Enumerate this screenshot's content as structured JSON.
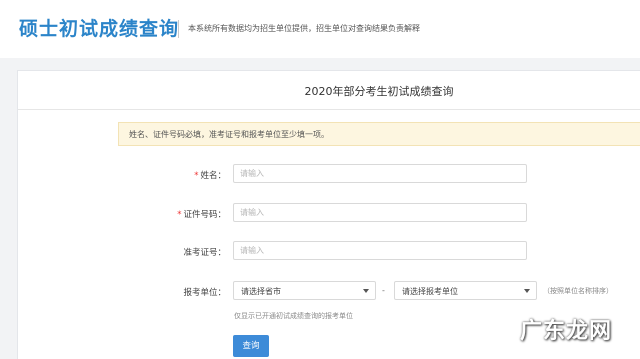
{
  "header": {
    "title": "硕士初试成绩查询",
    "note": "本系统所有数据均为招生单位提供，招生单位对查询结果负责解释"
  },
  "panel": {
    "title": "2020年部分考生初试成绩查询",
    "notice": "姓名、证件号码必填，准考证号和报考单位至少填一项。"
  },
  "form": {
    "required_mark": "*",
    "name_label": "姓名：",
    "name_placeholder": "请输入",
    "id_label": "证件号码：",
    "id_placeholder": "请输入",
    "exam_label": "准考证号：",
    "exam_placeholder": "请输入",
    "unit_label": "报考单位：",
    "province_select": "请选择省市",
    "unit_select": "请选择报考单位",
    "separator": "-",
    "sort_hint": "（按照单位名称排序）",
    "below_hint": "仅显示已开通初试成绩查询的报考单位",
    "submit_label": "查询"
  },
  "watermark": "广东龙网"
}
